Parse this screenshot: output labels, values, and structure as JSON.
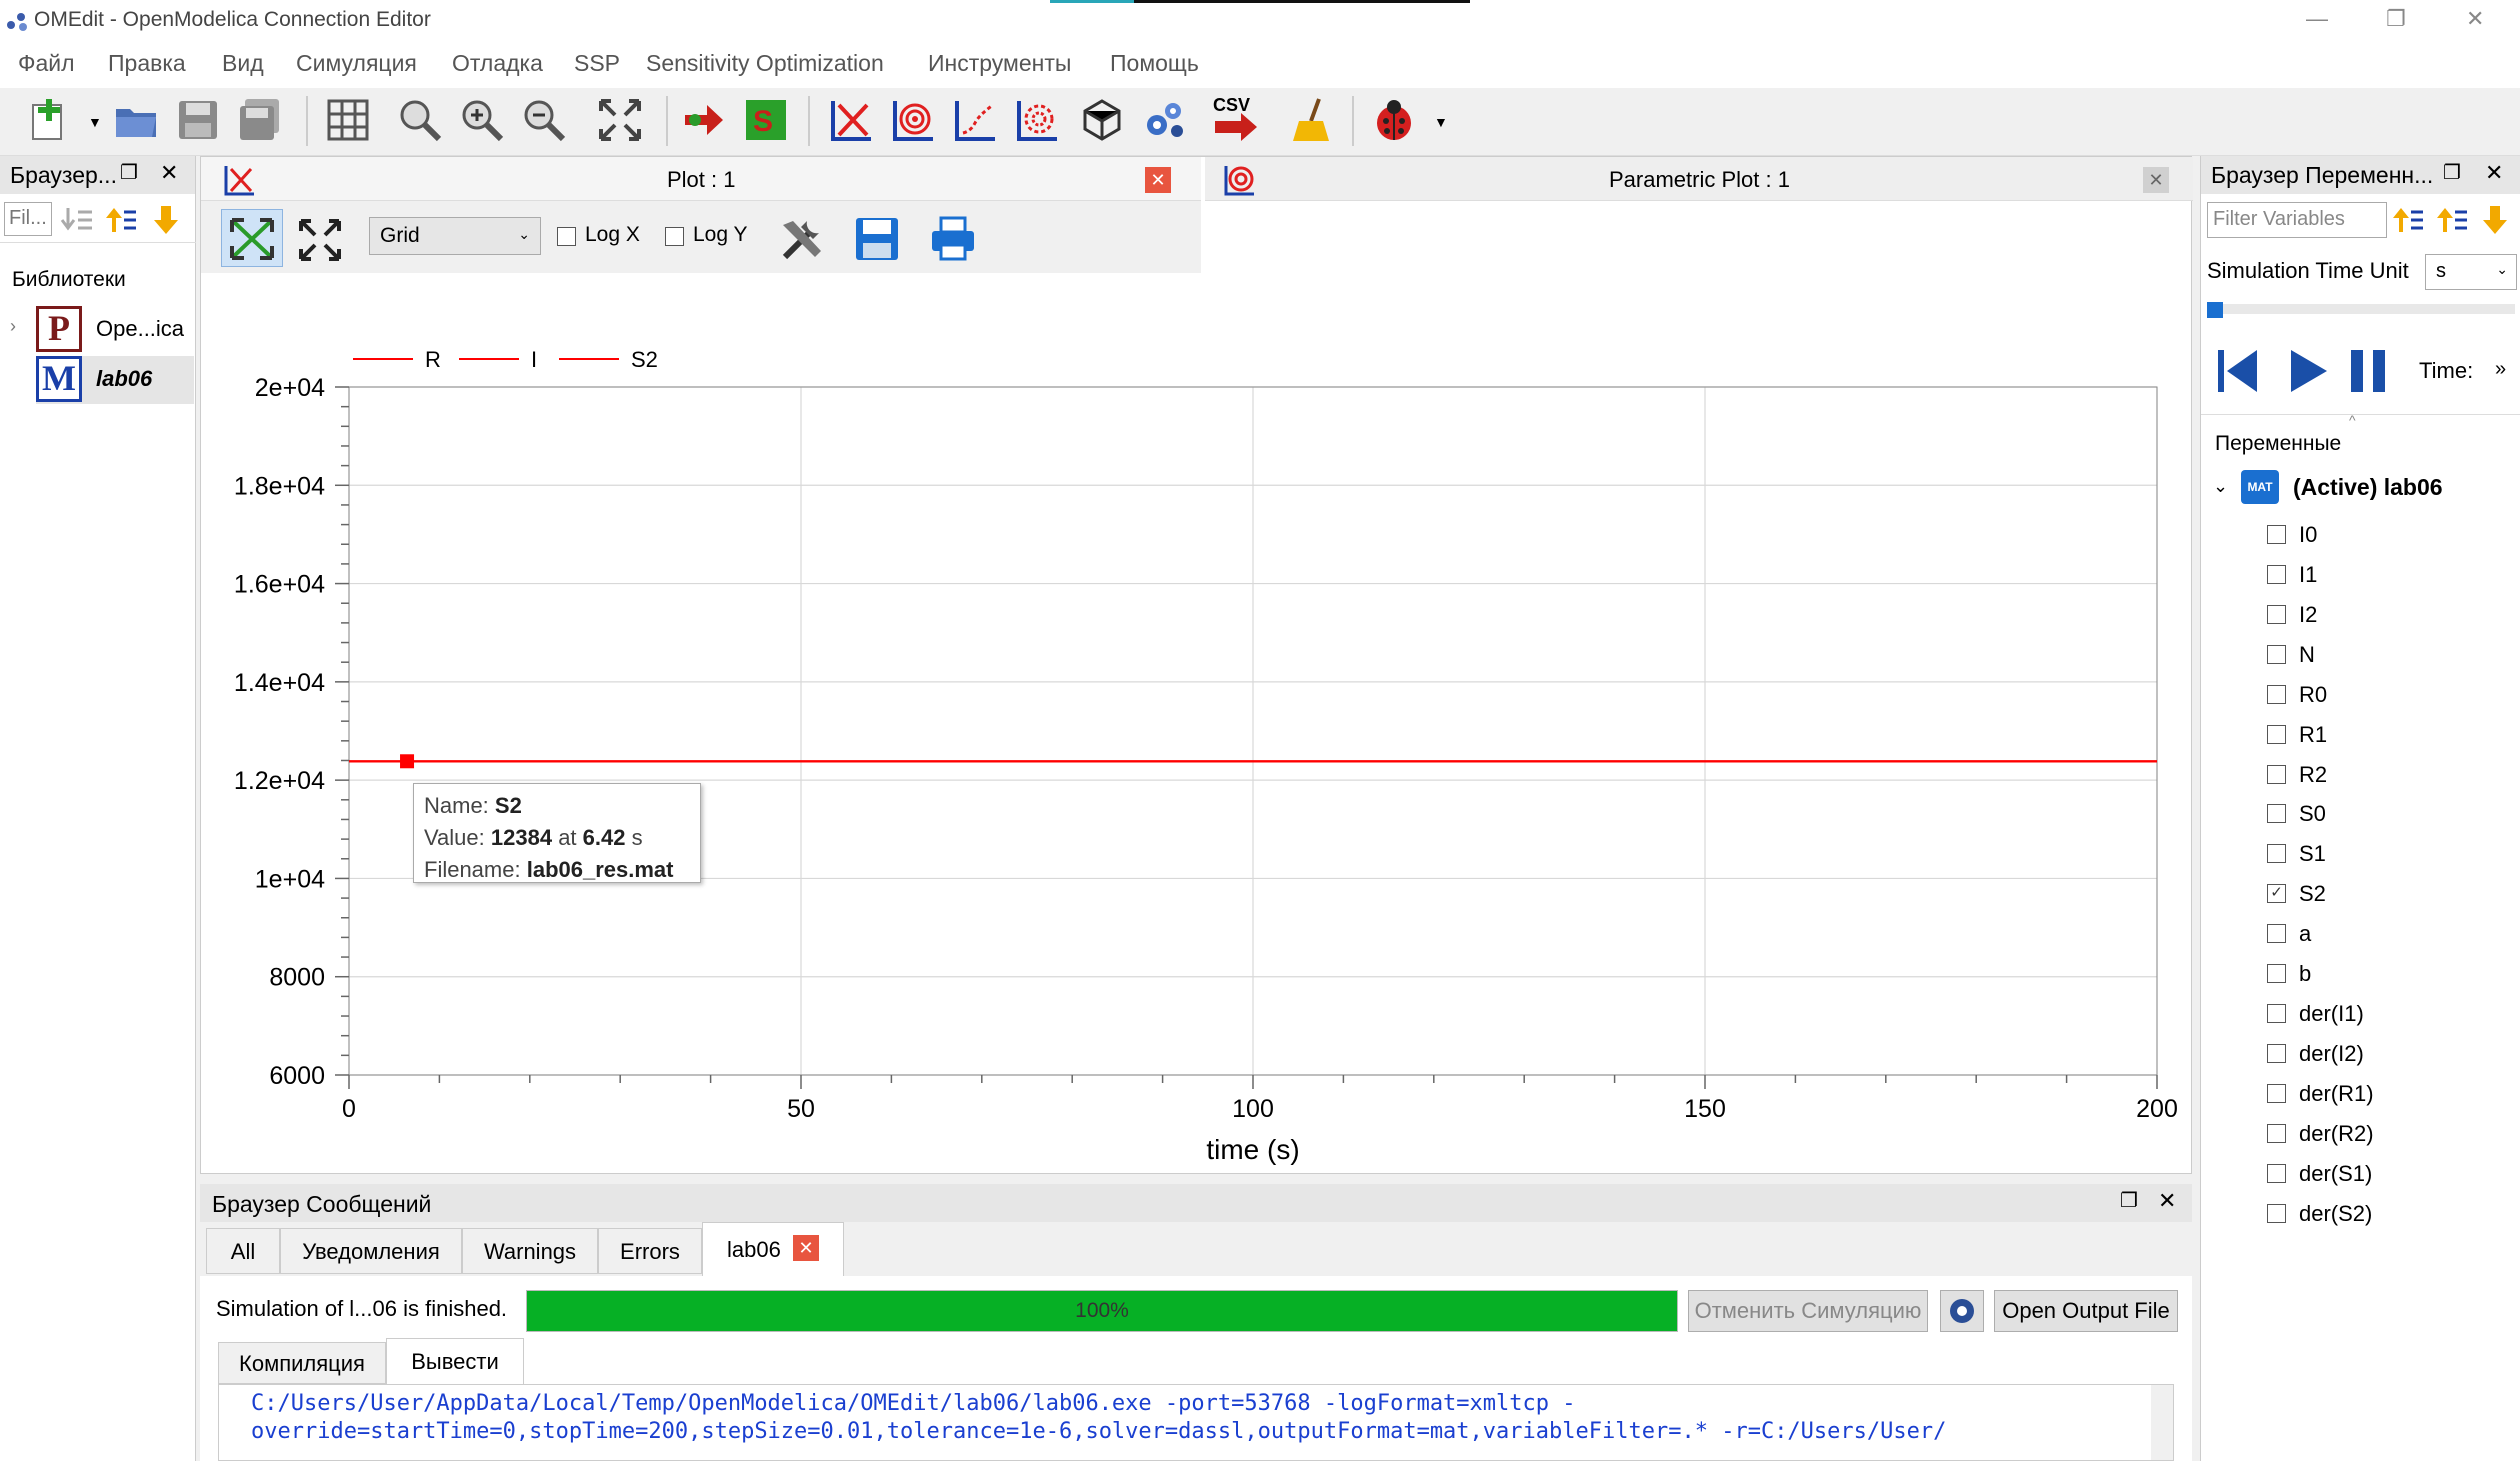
{
  "window": {
    "title": "OMEdit - OpenModelica Connection Editor"
  },
  "menu": [
    "Файл",
    "Правка",
    "Вид",
    "Симуляция",
    "Отладка",
    "SSP",
    "Sensitivity Optimization",
    "Инструменты",
    "Помощь"
  ],
  "toolbar": {
    "csv_label": "CSV"
  },
  "left_panel": {
    "title": "Браузер...",
    "filter_placeholder": "Fil...",
    "section": "Библиотеки",
    "items": [
      {
        "label": "Ope...ica"
      },
      {
        "label": "lab06"
      }
    ]
  },
  "plot_tab": {
    "title": "Plot : 1"
  },
  "parametric_tab": {
    "title": "Parametric Plot : 1"
  },
  "plot_toolbar": {
    "grid_value": "Grid",
    "logx": "Log X",
    "logy": "Log Y"
  },
  "tooltip": {
    "name_label": "Name:",
    "name_value": "S2",
    "value_label": "Value:",
    "value_value": "12384",
    "value_at": "at",
    "value_t": "6.42",
    "value_unit": "s",
    "file_label": "Filename:",
    "file_value": "lab06_res.mat"
  },
  "chart_data": {
    "type": "line",
    "legend": [
      "R",
      "I",
      "S2"
    ],
    "series": [
      {
        "name": "S2",
        "x": [
          0,
          200
        ],
        "y": [
          12384,
          12384
        ],
        "color": "#ff0000"
      }
    ],
    "marker": {
      "x": 6.42,
      "y": 12384
    },
    "xlabel": "time (s)",
    "xlim": [
      0,
      200
    ],
    "ylim": [
      6000,
      20000
    ],
    "xticks": [
      0,
      50,
      100,
      150,
      200
    ],
    "xtick_labels": [
      "0",
      "50",
      "100",
      "150",
      "200"
    ],
    "yticks": [
      6000,
      8000,
      10000,
      12000,
      14000,
      16000,
      18000,
      20000
    ],
    "ytick_labels": [
      "6000",
      "8000",
      "1e+04",
      "1.2e+04",
      "1.4e+04",
      "1.6e+04",
      "1.8e+04",
      "2e+04"
    ],
    "grid": true
  },
  "right_panel": {
    "title": "Браузер Переменн...",
    "filter_placeholder": "Filter Variables",
    "time_unit_label": "Simulation Time Unit",
    "time_unit_value": "s",
    "time_label": "Time:",
    "vars_header": "Переменные",
    "root": "(Active) lab06",
    "vars": [
      {
        "name": "I0",
        "checked": false
      },
      {
        "name": "I1",
        "checked": false
      },
      {
        "name": "I2",
        "checked": false
      },
      {
        "name": "N",
        "checked": false
      },
      {
        "name": "R0",
        "checked": false
      },
      {
        "name": "R1",
        "checked": false
      },
      {
        "name": "R2",
        "checked": false
      },
      {
        "name": "S0",
        "checked": false
      },
      {
        "name": "S1",
        "checked": false
      },
      {
        "name": "S2",
        "checked": true
      },
      {
        "name": "a",
        "checked": false
      },
      {
        "name": "b",
        "checked": false
      },
      {
        "name": "der(I1)",
        "checked": false
      },
      {
        "name": "der(I2)",
        "checked": false
      },
      {
        "name": "der(R1)",
        "checked": false
      },
      {
        "name": "der(R2)",
        "checked": false
      },
      {
        "name": "der(S1)",
        "checked": false
      },
      {
        "name": "der(S2)",
        "checked": false
      }
    ]
  },
  "messages": {
    "title": "Браузер Сообщений",
    "tabs": [
      "All",
      "Уведомления",
      "Warnings",
      "Errors",
      "lab06"
    ],
    "status": "Simulation of l...06 is finished.",
    "progress": 100,
    "progress_label": "100%",
    "cancel_label": "Отменить Симуляцию",
    "open_output_label": "Open Output File",
    "subtabs": [
      "Компиляция",
      "Вывести"
    ],
    "output_lines": [
      "C:/Users/User/AppData/Local/Temp/OpenModelica/OMEdit/lab06/lab06.exe -port=53768 -logFormat=xmltcp -",
      "override=startTime=0,stopTime=200,stepSize=0.01,tolerance=1e-6,solver=dassl,outputFormat=mat,variableFilter=.* -r=C:/Users/User/"
    ]
  }
}
